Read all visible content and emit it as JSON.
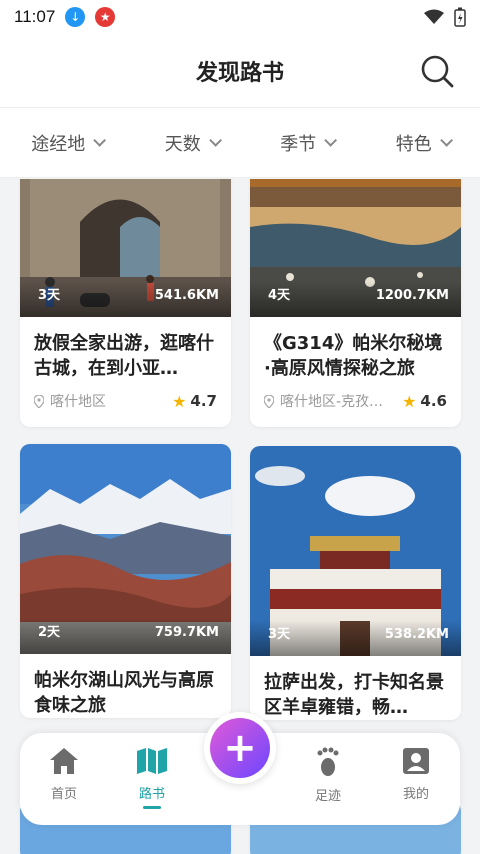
{
  "status": {
    "time": "11:07"
  },
  "header": {
    "title": "发现路书"
  },
  "filters": [
    {
      "label": "途经地"
    },
    {
      "label": "天数"
    },
    {
      "label": "季节"
    },
    {
      "label": "特色"
    }
  ],
  "cards": [
    {
      "days": "3天",
      "distance": "541.6KM",
      "title": "放假全家出游，逛喀什古城，在到小亚…",
      "place": "喀什地区",
      "rating": "4.7"
    },
    {
      "days": "4天",
      "distance": "1200.7KM",
      "title": "《G314》帕米尔秘境·高原风情探秘之旅",
      "place": "喀什地区-克孜…",
      "rating": "4.6"
    },
    {
      "days": "2天",
      "distance": "759.7KM",
      "title": "帕米尔湖山风光与高原食味之旅",
      "place": "",
      "rating": ""
    },
    {
      "days": "3天",
      "distance": "538.2KM",
      "title": "拉萨出发，打卡知名景区羊卓雍错，畅…",
      "place": "",
      "rating": ""
    }
  ],
  "tabbar": {
    "items": [
      {
        "label": "首页"
      },
      {
        "label": "路书"
      },
      {
        "label": "足迹"
      },
      {
        "label": "我的"
      }
    ],
    "active": "路书"
  },
  "colors": {
    "accent": "#1fa4a8",
    "fab_start": "#e15ad8",
    "fab_end": "#6b46ff",
    "star": "#f5b400"
  }
}
